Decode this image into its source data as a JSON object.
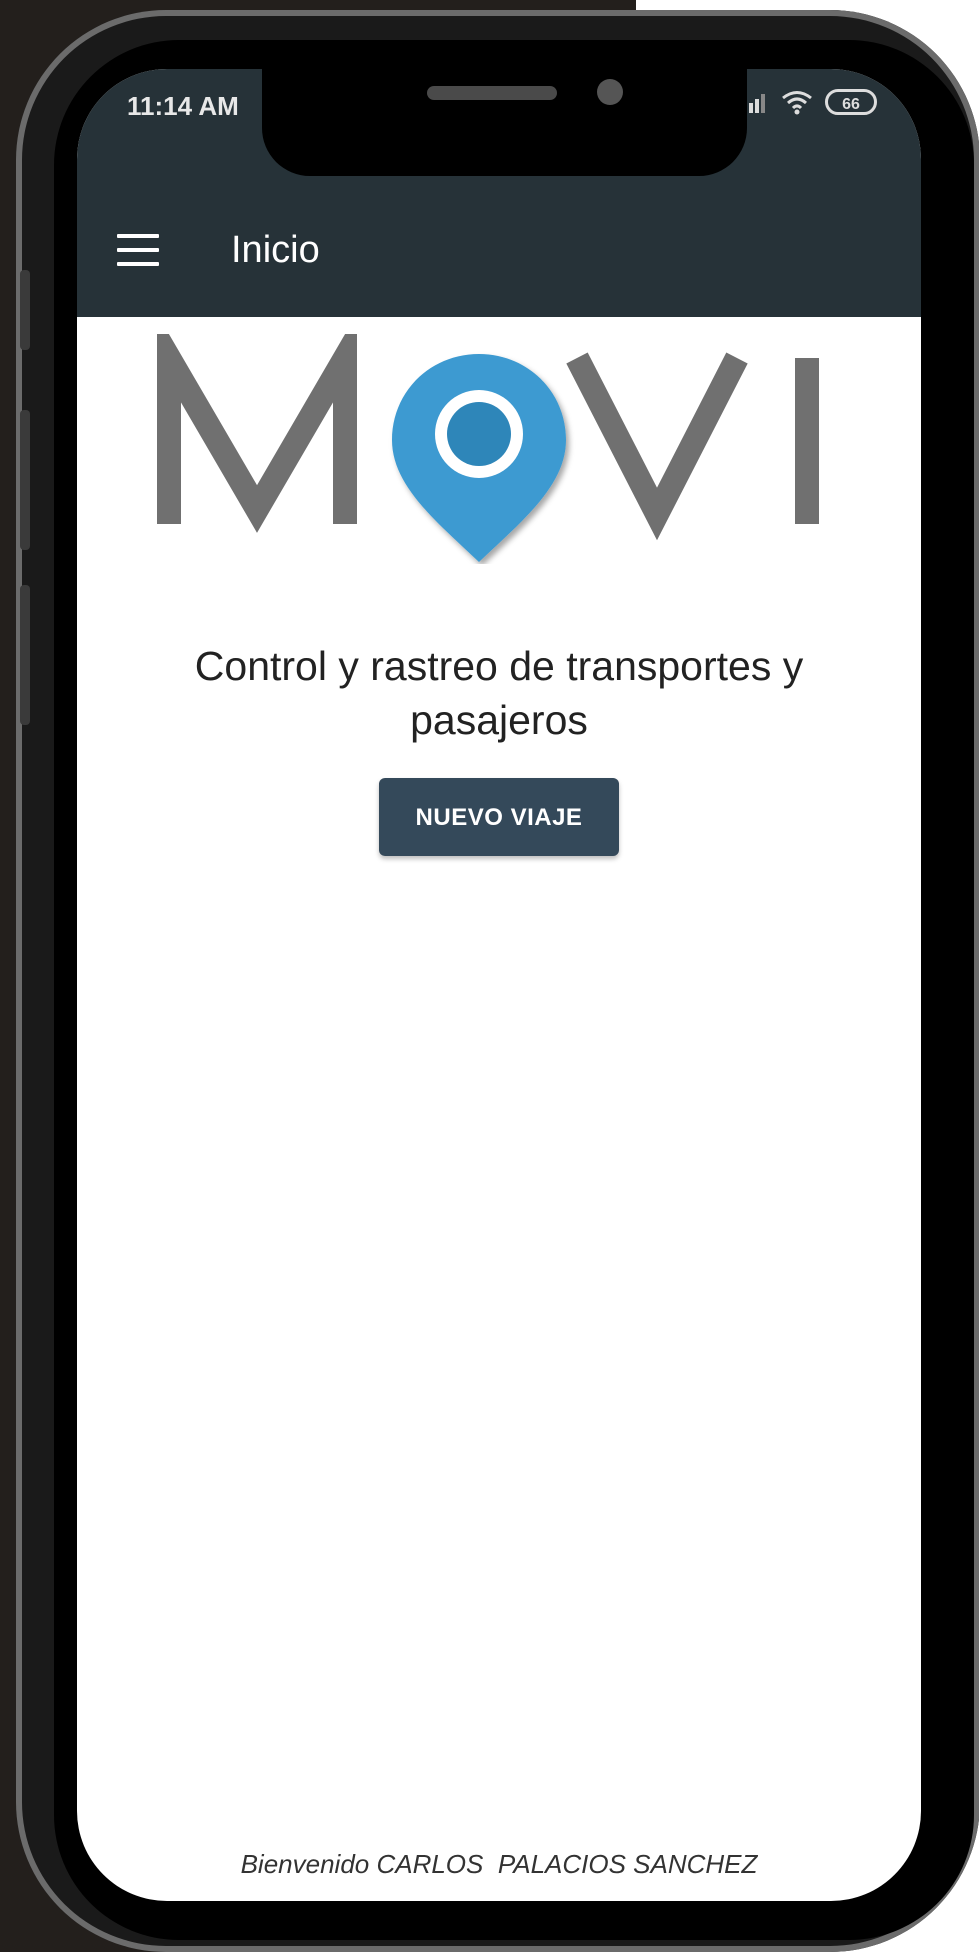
{
  "status_bar": {
    "time": "11:14 AM",
    "battery_level": "66",
    "icons": [
      "signal-icon",
      "wifi-icon",
      "battery-icon"
    ]
  },
  "app_bar": {
    "title": "Inicio",
    "menu_icon": "hamburger-menu-icon"
  },
  "logo": {
    "text_left": "M",
    "text_right": "VI",
    "pin_icon": "location-pin-icon",
    "colors": {
      "letters": "#707070",
      "pin": "#3d9ad1",
      "pin_dot": "#2f86b9"
    }
  },
  "main": {
    "tagline": "Control y rastreo de transportes y pasajeros",
    "new_trip_button": "NUEVO VIAJE"
  },
  "footer": {
    "welcome": "Bienvenido CARLOS  PALACIOS SANCHEZ"
  },
  "colors": {
    "app_bar": "#263238",
    "button": "#34495a",
    "background": "#ffffff"
  }
}
